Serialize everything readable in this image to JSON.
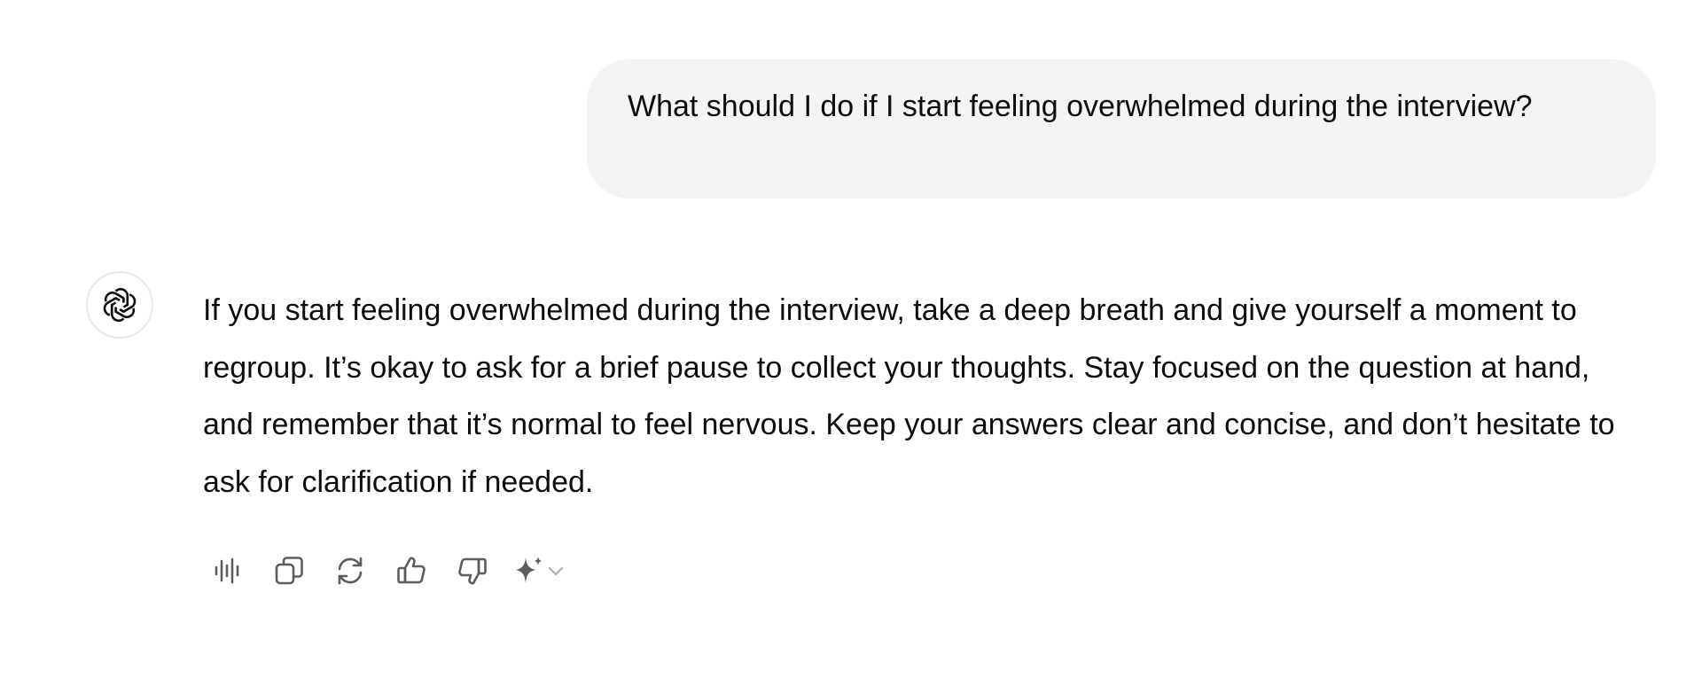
{
  "user_message": {
    "text": "What should I do if I start feeling overwhelmed during the interview?"
  },
  "assistant_message": {
    "avatar_icon": "openai-logo-icon",
    "text": "If you start feeling overwhelmed during the interview, take a deep breath and give yourself a moment to regroup. It’s okay to ask for a brief pause to collect your thoughts. Stay focused on the question at hand, and remember that it’s normal to feel nervous. Keep your answers clear and concise, and don’t hesitate to ask for clarification if needed."
  },
  "actions": [
    {
      "name": "read-aloud",
      "icon": "audio-waveform-icon"
    },
    {
      "name": "copy",
      "icon": "copy-icon"
    },
    {
      "name": "regenerate",
      "icon": "refresh-icon"
    },
    {
      "name": "good-response",
      "icon": "thumbs-up-icon"
    },
    {
      "name": "bad-response",
      "icon": "thumbs-down-icon"
    },
    {
      "name": "switch-model",
      "icon": "sparkle-icon"
    }
  ],
  "colors": {
    "bubble_bg": "#f4f4f4",
    "text": "#0d0d0d",
    "icon": "#5d5d5d"
  }
}
